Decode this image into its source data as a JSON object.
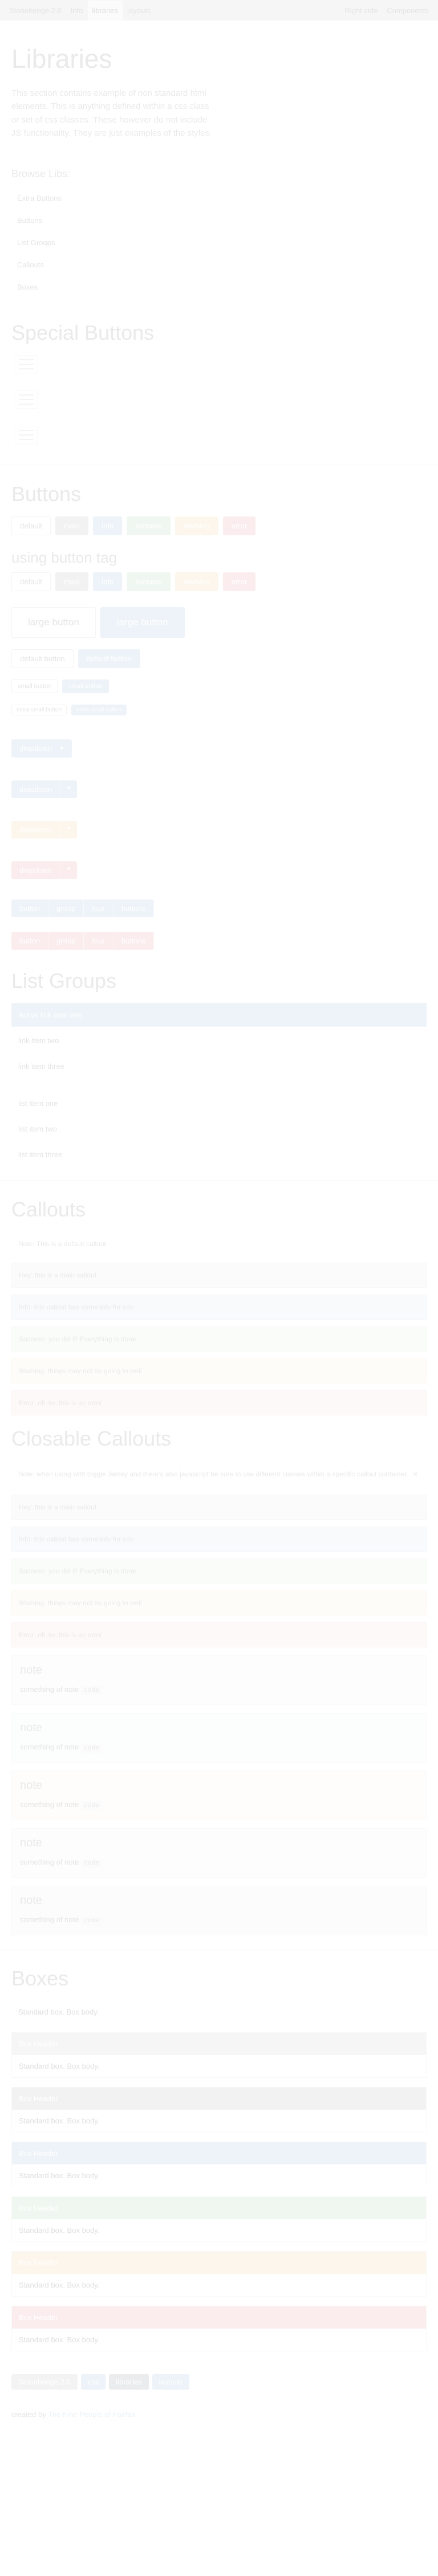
{
  "navbar": {
    "brand": "Stonehenge 2.0",
    "items": [
      "Info",
      "libraries",
      "layouts"
    ],
    "active_index": 1,
    "right": [
      "Right side",
      "Components"
    ]
  },
  "title": "Libraries",
  "lead": "This section contains example of non standard html elements. This is anything defined within a css class or set of css classes. These however do not include JS functionality. They are just examples of the styles.",
  "browse": {
    "heading": "Browse Libs:",
    "items": [
      "Extra Buttons",
      "Buttons",
      "List Groups",
      "Callouts",
      "Boxes"
    ]
  },
  "special_buttons": {
    "heading": "Special Buttons"
  },
  "buttons": {
    "heading": "Buttons",
    "row": [
      "default",
      "main",
      "info",
      "success",
      "warning",
      "error"
    ],
    "tag_heading": "using button tag",
    "tag_row": [
      "default",
      "main",
      "info",
      "success",
      "warning",
      "error"
    ],
    "large": [
      "large button",
      "large button"
    ],
    "normal": [
      "default button",
      "default button"
    ],
    "small": [
      "small button",
      "small button"
    ],
    "xs": [
      "extra small button",
      "extra small button"
    ],
    "dropdowns": [
      {
        "label": "dropdown",
        "style": "info",
        "split": false
      },
      {
        "label": "dropdown",
        "style": "info",
        "split": true
      },
      {
        "label": "dropdown",
        "style": "warning",
        "split": true
      },
      {
        "label": "dropdown",
        "style": "error",
        "split": true
      }
    ],
    "group1": [
      "button",
      "group",
      "four",
      "buttons"
    ],
    "group2": [
      "button",
      "group",
      "four",
      "buttons"
    ]
  },
  "list_groups": {
    "heading": "List Groups",
    "group1": [
      "Active link item one",
      "link item two",
      "link item three"
    ],
    "group2": [
      "list item one",
      "list item two",
      "list item three"
    ]
  },
  "callouts": {
    "heading": "Callouts",
    "items": [
      {
        "style": "default",
        "text": "Note: This is a default callout."
      },
      {
        "style": "main",
        "text": "Hey: this is a main callout"
      },
      {
        "style": "info",
        "text": "Info: this callout has some info for you"
      },
      {
        "style": "success",
        "text": "Success: you did it! Everything is done."
      },
      {
        "style": "warning",
        "text": "Warning: things may not be going to well"
      },
      {
        "style": "error",
        "text": "Error: oh no, this is an error"
      }
    ]
  },
  "closable": {
    "heading": "Closable Callouts",
    "note": "Note: when using with toggle Jersey and there's also javascript be sure to use different classes within a specific callout container.",
    "items": [
      {
        "style": "main",
        "text": "Hey: this is a main callout"
      },
      {
        "style": "info",
        "text": "Info: this callout has some info for you"
      },
      {
        "style": "success",
        "text": "Success: you did it! Everything is done."
      },
      {
        "style": "warning",
        "text": "Warning: things may not be going to well"
      },
      {
        "style": "error",
        "text": "Error: oh no, this is an error"
      }
    ],
    "notes": [
      {
        "title": "note",
        "body": "something of note",
        "code": "code"
      },
      {
        "title": "note",
        "body": "something of note",
        "code": "code"
      },
      {
        "title": "note",
        "body": "something of note",
        "code": "code"
      },
      {
        "title": "note",
        "body": "something of note",
        "code": "code"
      },
      {
        "title": "note",
        "body": "something of note",
        "code": "code"
      }
    ]
  },
  "boxes": {
    "heading": "Boxes",
    "items": [
      {
        "header": "",
        "body": "Standard box. Box body.",
        "color": ""
      },
      {
        "header": "Box Header",
        "body": "Standard box. Box body.",
        "color": "#dcdcdc"
      },
      {
        "header": "Box Header",
        "body": "Standard box. Box body.",
        "color": "#d6d8dc"
      },
      {
        "header": "Box Header",
        "body": "Standard box. Box body.",
        "color": "#c8dcec"
      },
      {
        "header": "Box Header",
        "body": "Standard box. Box body.",
        "color": "#cfe8cf"
      },
      {
        "header": "Box Header",
        "body": "Standard box. Box body.",
        "color": "#fbe3c4"
      },
      {
        "header": "Box Header",
        "body": "Standard box. Box body.",
        "color": "#f5c6c6"
      }
    ]
  },
  "footer": {
    "labels": [
      {
        "text": "Stonehenge 2.0",
        "color": "#dcdcdc"
      },
      {
        "text": "css",
        "color": "#c8dcec"
      },
      {
        "text": "libraries",
        "color": "#c0c3c8"
      },
      {
        "text": "layouts",
        "color": "#c8dcec"
      }
    ],
    "credit_prefix": "created by",
    "credit_link": "The Fine People of Fairfax"
  }
}
